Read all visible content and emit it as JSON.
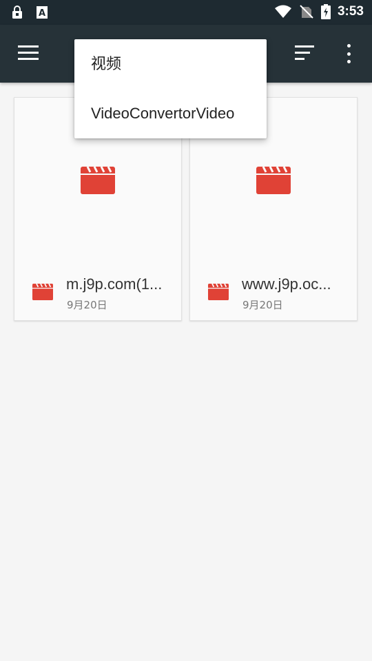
{
  "status_bar": {
    "time": "3:53",
    "icons": [
      "lock-icon",
      "font-icon",
      "wifi-icon",
      "no-sim-icon",
      "battery-charging-icon"
    ]
  },
  "app_bar": {
    "icons": [
      "menu-icon",
      "sort-icon",
      "more-vert-icon"
    ]
  },
  "files": [
    {
      "name": "m.j9p.com(1...",
      "date": "9月20日",
      "icon": "video-clapperboard-icon"
    },
    {
      "name": "www.j9p.oc...",
      "date": "9月20日",
      "icon": "video-clapperboard-icon"
    }
  ],
  "popup_menu": {
    "items": [
      "视频",
      "VideoConvertorVideo"
    ]
  },
  "colors": {
    "status_bar": "#1e2a31",
    "app_bar": "#263238",
    "accent_red": "#e04236",
    "background": "#f5f5f5"
  }
}
